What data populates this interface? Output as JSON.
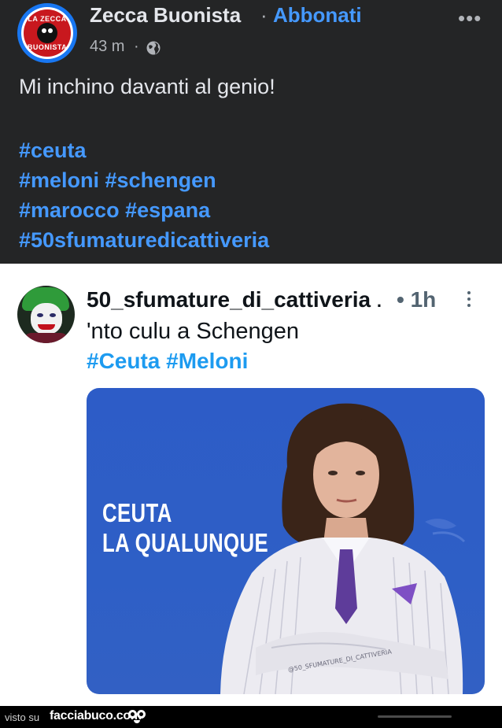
{
  "facebook_post": {
    "page_name": "Zecca Buonista",
    "separator": "·",
    "follow_label": "Abbonati",
    "more_label": "•••",
    "time": "43 m",
    "time_separator": "·",
    "privacy_icon": "globe-icon",
    "avatar_text_top": "LA ZECCA",
    "avatar_text_bottom": "BUONISTA",
    "text": "Mi inchino davanti al genio!",
    "hashtag_lines": [
      "#ceuta",
      "#meloni #schengen",
      "#marocco #espana",
      "#50sfumaturedicattiveria"
    ],
    "colors": {
      "background": "#242526",
      "link": "#4599ff",
      "text": "#e4e6eb"
    }
  },
  "tweet": {
    "username": "50_sfumature_di_cattiveria",
    "truncation": ".",
    "time": "• 1h",
    "more_icon": "vertical-ellipsis-icon",
    "text": "'nto culu a Schengen",
    "hashtags": "#Ceuta #Meloni",
    "image": {
      "caption_line1": "CEUTA",
      "caption_line2": "LA QUALUNQUE",
      "watermark": "@50_SFUMATURE_DI_CATTIVERIA",
      "background": "#2d5cc7"
    },
    "colors": {
      "link": "#1d9bf0",
      "text": "#0f1419",
      "muted": "#536471"
    }
  },
  "footer": {
    "prefix": "visto su",
    "site": "facciabuco.com",
    "mascot_icon": "eyes-mascot-icon"
  }
}
